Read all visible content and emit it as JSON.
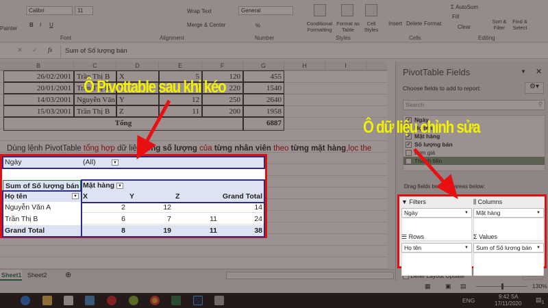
{
  "ribbon": {
    "clipboard": {
      "painter": "Painter"
    },
    "font": {
      "name": "Calibri",
      "size": "11",
      "label": "Font",
      "bold": "B",
      "italic": "I",
      "underline": "U"
    },
    "alignment": {
      "wrap_text": "Wrap Text",
      "merge_center": "Merge & Center",
      "label": "Alignment"
    },
    "number": {
      "format": "General",
      "percent": "%",
      "comma": ",",
      "label": "Number"
    },
    "styles": {
      "conditional": "Conditional Formatting",
      "format_table": "Format as Table",
      "cell_styles": "Cell Styles",
      "label": "Styles"
    },
    "cells": {
      "insert": "Insert",
      "delete": "Delete",
      "format": "Format",
      "label": "Cells"
    },
    "editing": {
      "autosum": "AutoSum",
      "fill": "Fill",
      "clear": "Clear",
      "sort_filter": "Sort & Filter",
      "find_select": "Find & Select",
      "label": "Editing"
    }
  },
  "formula_bar": {
    "fx": "fx",
    "value": "Sum of Số lượng bán"
  },
  "columns": [
    "B",
    "C",
    "D",
    "E",
    "F",
    "G",
    "H",
    "I"
  ],
  "data_rows": [
    {
      "date": "26/02/2001",
      "name": "Trần Thị B",
      "item": "X",
      "qty": "5",
      "price": "120",
      "total": "455"
    },
    {
      "date": "20/01/2001",
      "name": "Trần Thị B",
      "item": "Y",
      "qty": "7",
      "price": "220",
      "total": "1540"
    },
    {
      "date": "14/03/2001",
      "name": "Nguyễn Văn A",
      "item": "Y",
      "qty": "12",
      "price": "250",
      "total": "2640"
    },
    {
      "date": "15/03/2001",
      "name": "Trần Thị B",
      "item": "Z",
      "qty": "11",
      "price": "200",
      "total": "1958"
    }
  ],
  "total_row": {
    "label": "Tổng",
    "value": "6887"
  },
  "instruction": {
    "p1": "Dùng lệnh PivotTable ",
    "p2": "tổng hợp",
    "p3": " dữ liệu ",
    "p4": "tổng số lượng",
    "p5": " của ",
    "p6": "từng nhân viên",
    "p7": " theo ",
    "p8": "từng mặt hàng",
    "p9": ",lọc the"
  },
  "pivot": {
    "filter_label": "Ngày",
    "filter_value": "(All)",
    "values_label": "Sum of Số lượng bán",
    "col_field": "Mặt hàng",
    "row_field": "Họ tên",
    "col_headers": [
      "X",
      "Y",
      "Z",
      "Grand Total"
    ],
    "rows": [
      {
        "name": "Nguyễn Văn A",
        "values": [
          "2",
          "12",
          "",
          "14"
        ]
      },
      {
        "name": "Trần Thị B",
        "values": [
          "6",
          "7",
          "11",
          "24"
        ]
      }
    ],
    "grand_total": {
      "name": "Grand Total",
      "values": [
        "8",
        "19",
        "11",
        "38"
      ]
    }
  },
  "pane": {
    "title": "PivotTable Fields",
    "subtitle": "Choose fields to add to report:",
    "search_placeholder": "Search",
    "fields": [
      {
        "name": "Ngày",
        "checked": true
      },
      {
        "name": "Họ tên",
        "checked": true
      },
      {
        "name": "Mặt hàng",
        "checked": true
      },
      {
        "name": "Số lượng bán",
        "checked": true
      },
      {
        "name": "Đơn giá",
        "checked": false
      },
      {
        "name": "Thành tiền",
        "checked": false
      }
    ],
    "drag_label": "Drag fields between areas below:",
    "areas": {
      "filters": {
        "title": "Filters",
        "value": "Ngày"
      },
      "columns": {
        "title": "Columns",
        "value": "Mặt hàng"
      },
      "rows": {
        "title": "Rows",
        "value": "Họ tên"
      },
      "values": {
        "title": "Values",
        "value": "Sum of Số lượng bán"
      }
    },
    "defer": "Defer Layout Update",
    "update": "Update"
  },
  "sheets": [
    "Sheet1",
    "Sheet2"
  ],
  "status": {
    "zoom": "130%"
  },
  "taskbar": {
    "lang": "ENG",
    "time": "9:42 SA",
    "date": "17/11/2020",
    "notif": "1"
  },
  "annotations": {
    "pivot_cell": "Ô Pivottable sau khi kéo",
    "data_cell": "Ô dữ liệu chỉnh sửa"
  }
}
